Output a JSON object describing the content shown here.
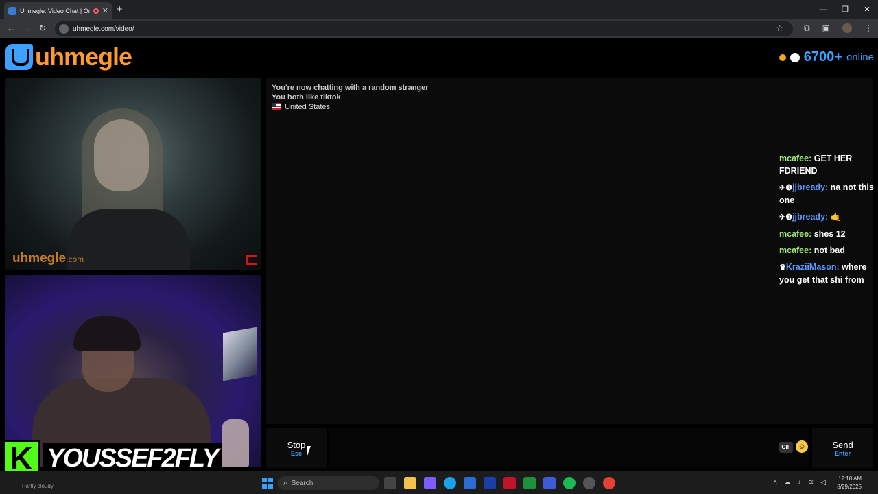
{
  "browser": {
    "tab_title": "Uhmegle: Video Chat | Ome",
    "new_tab": "+",
    "url": "uhmegle.com/video/",
    "window_controls": [
      "—",
      "❐",
      "✕"
    ]
  },
  "site": {
    "logo_text": "uhmegle",
    "online_count": "6700+",
    "online_label": "online"
  },
  "stranger_video": {
    "watermark": "uhmegle",
    "watermark_suffix": ".com"
  },
  "self_video": {
    "streamer_badge_letter": "K",
    "streamer_name": "YOUSSEF2FLY"
  },
  "chat": {
    "system_lines": [
      "You're now chatting with a random stranger",
      "You both like tiktok",
      "United States"
    ],
    "messages": [
      {
        "user": "mcafee:",
        "text": "GET HER FDRIEND",
        "style": "green",
        "icons": ""
      },
      {
        "user": "jjbready:",
        "text": "na not this one",
        "style": "blue",
        "icons": "✈❶"
      },
      {
        "user": "jjbready:",
        "text": "🤙",
        "style": "blue",
        "icons": "✈❶"
      },
      {
        "user": "mcafee:",
        "text": "shes 12",
        "style": "green",
        "icons": ""
      },
      {
        "user": "mcafee:",
        "text": "not bad",
        "style": "green",
        "icons": ""
      },
      {
        "user": "KraziiMason:",
        "text": "where you get that shi from",
        "style": "blue",
        "icons": "♛"
      }
    ]
  },
  "controls": {
    "stop_label": "Stop",
    "stop_hint": "Esc",
    "gif_label": "GIF",
    "send_label": "Send",
    "send_hint": "Enter"
  },
  "taskbar": {
    "weather": "Partly cloudy",
    "search_placeholder": "Search",
    "time": "12:18 AM",
    "date": "8/29/2025"
  }
}
